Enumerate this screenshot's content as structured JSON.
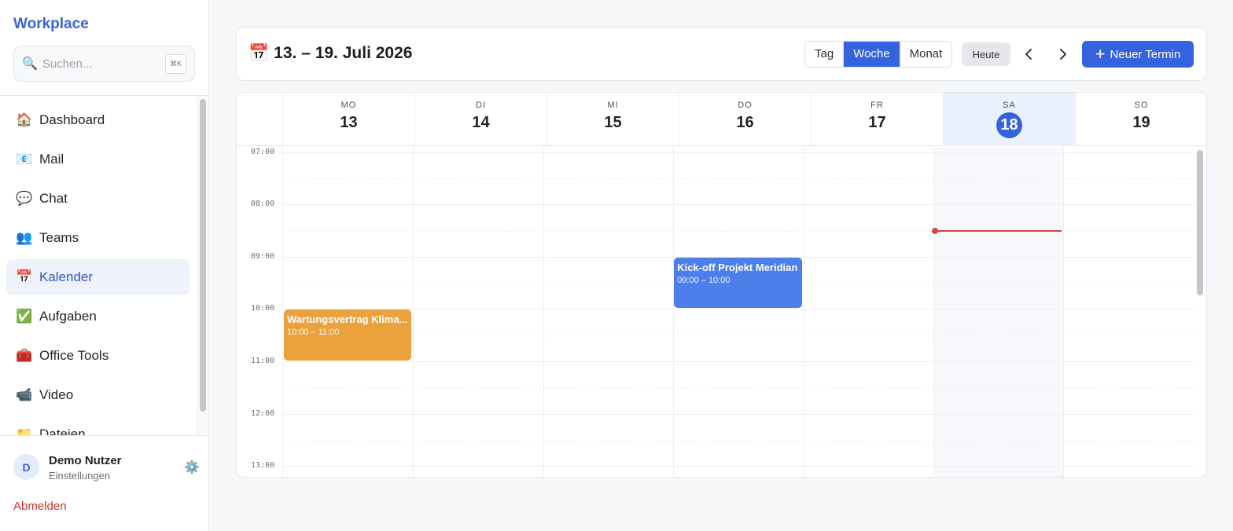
{
  "sidebar": {
    "brand": "Workplace",
    "search": {
      "placeholder": "Suchen...",
      "shortcut": "⌘K",
      "icon": "magnifier-icon"
    },
    "items": [
      {
        "key": "dashboard",
        "icon": "🏠",
        "label": "Dashboard",
        "active": false
      },
      {
        "key": "mail",
        "icon": "📧",
        "label": "Mail",
        "active": false
      },
      {
        "key": "chat",
        "icon": "💬",
        "label": "Chat",
        "active": false
      },
      {
        "key": "teams",
        "icon": "👥",
        "label": "Teams",
        "active": false
      },
      {
        "key": "kalender",
        "icon": "📅",
        "label": "Kalender",
        "active": true
      },
      {
        "key": "aufgaben",
        "icon": "✅",
        "label": "Aufgaben",
        "active": false
      },
      {
        "key": "office-tools",
        "icon": "🧰",
        "label": "Office Tools",
        "active": false
      },
      {
        "key": "video",
        "icon": "📹",
        "label": "Video",
        "active": false
      },
      {
        "key": "dateien",
        "icon": "📁",
        "label": "Dateien",
        "active": false
      }
    ],
    "user": {
      "initial": "D",
      "name": "Demo Nutzer",
      "subtitle": "Einstellungen"
    },
    "logout": "Abmelden"
  },
  "header": {
    "title": "13. – 19. Juli 2026",
    "views": [
      {
        "label": "Tag",
        "active": false
      },
      {
        "label": "Woche",
        "active": true
      },
      {
        "label": "Monat",
        "active": false
      }
    ],
    "today_label": "Heute",
    "new_event_label": "Neuer Termin"
  },
  "calendar": {
    "days": [
      {
        "weekday": "MO",
        "day": "13",
        "today": false
      },
      {
        "weekday": "DI",
        "day": "14",
        "today": false
      },
      {
        "weekday": "MI",
        "day": "15",
        "today": false
      },
      {
        "weekday": "DO",
        "day": "16",
        "today": false
      },
      {
        "weekday": "FR",
        "day": "17",
        "today": false
      },
      {
        "weekday": "SA",
        "day": "18",
        "today": true
      },
      {
        "weekday": "SO",
        "day": "19",
        "today": false
      }
    ],
    "hours": [
      "07:00",
      "08:00",
      "09:00",
      "10:00",
      "11:00",
      "12:00",
      "13:00"
    ],
    "first_hour": 7,
    "visible_start_hour": 6.9,
    "now": {
      "day_index": 5,
      "hour": 8.5
    },
    "events": [
      {
        "title": "Kick-off Projekt Meridian",
        "time": "09:00 – 10:00",
        "day_index": 3,
        "start": 9,
        "end": 10,
        "color": "#4c7fea"
      },
      {
        "title": "Wartungsvertrag Klima...",
        "time": "10:00 – 11:00",
        "day_index": 0,
        "start": 10,
        "end": 11,
        "color": "#eba23c"
      }
    ]
  },
  "colors": {
    "accent": "#3563e0",
    "brand": "#3a63d8",
    "now_line": "#d9423d",
    "danger": "#c9302c"
  }
}
